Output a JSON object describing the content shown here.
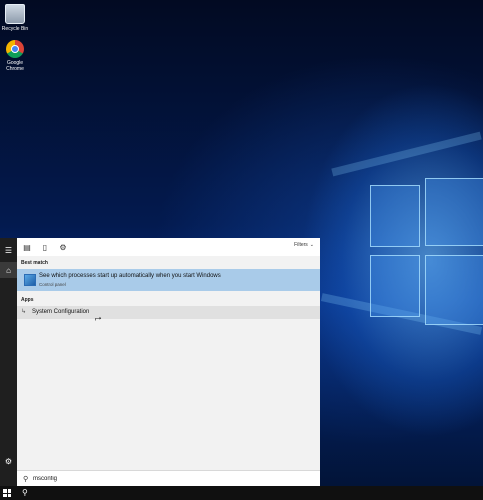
{
  "desktop": {
    "icons": [
      {
        "label": "Recycle Bin",
        "icon": "recycle-bin-icon"
      },
      {
        "label": "Google Chrome",
        "icon": "chrome-icon"
      }
    ]
  },
  "start_menu": {
    "rail": {
      "menu_icon": "hamburger-icon",
      "home_icon": "home-icon",
      "settings_icon": "gear-icon"
    },
    "toolbar": {
      "filters_label": "Filters",
      "icons": [
        "apps-view-icon",
        "document-icon",
        "gear-icon"
      ]
    },
    "best_match": {
      "section": "Best match",
      "title": "See which processes start up automatically when you start Windows",
      "subtitle": "Control panel"
    },
    "apps": {
      "section": "Apps",
      "items": [
        {
          "label": "System Configuration",
          "icon": "msconfig-icon"
        }
      ]
    },
    "search": {
      "value": "msconfig",
      "icon": "search-icon"
    }
  },
  "taskbar": {
    "start_icon": "windows-logo-icon",
    "search_icon": "search-icon"
  },
  "colors": {
    "highlight": "#a9cbe9",
    "panel": "#f2f2f2",
    "rail": "#1f1f1f",
    "taskbar": "#101010"
  }
}
